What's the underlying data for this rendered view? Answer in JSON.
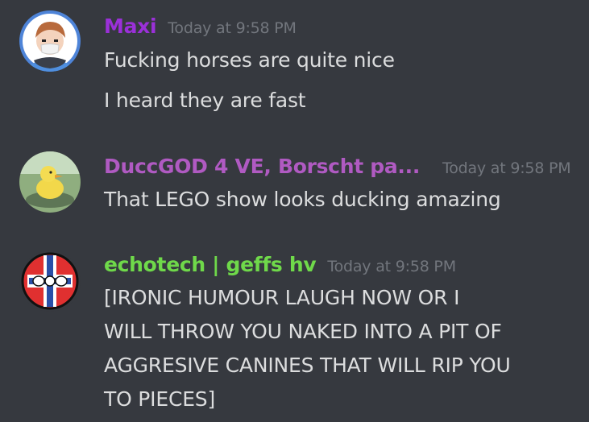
{
  "messages": [
    {
      "author": "Maxi",
      "author_color": "#9b30d9",
      "timestamp": "Today at 9:58 PM",
      "lines": [
        "Fucking horses are quite nice",
        "I heard they are fast"
      ]
    },
    {
      "author": "DuccGOD 4 VE, Borscht pa...",
      "author_color": "#b05ac2",
      "timestamp": "Today at 9:58 PM",
      "lines": [
        "That LEGO show looks ducking amazing"
      ]
    },
    {
      "author": "echotech | geffs hv",
      "author_color": "#6fd94a",
      "timestamp": "Today at 9:58 PM",
      "lines": [
        "[IRONIC HUMOUR LAUGH NOW OR I",
        "WILL THROW YOU NAKED INTO A PIT OF",
        "AGGRESIVE CANINES THAT WILL RIP YOU",
        "TO PIECES]"
      ]
    }
  ]
}
